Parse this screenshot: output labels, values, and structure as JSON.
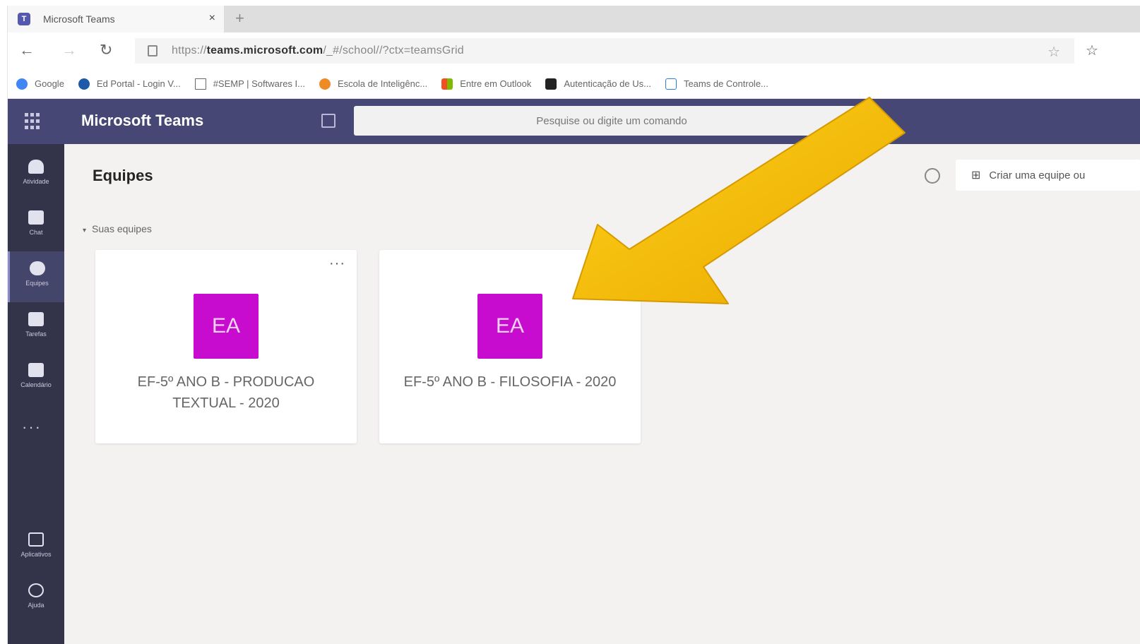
{
  "browser": {
    "tab_title": "Microsoft Teams",
    "tab_close": "×",
    "tab_new": "+",
    "url_prefix": "https://",
    "url_host": "teams.microsoft.com",
    "url_path": "/_#/school//?ctx=teamsGrid",
    "bookmarks": [
      {
        "label": "Google",
        "icon": "google-icon",
        "color": "#4285f4"
      },
      {
        "label": "Ed Portal - Login V...",
        "icon": "portal-icon",
        "color": "#1e5aa8"
      },
      {
        "label": "#SEMP | Softwares I...",
        "icon": "page-icon",
        "color": "#666666"
      },
      {
        "label": "Escola de Inteligênc...",
        "icon": "orange-dot-icon",
        "color": "#f08a24"
      },
      {
        "label": "Entre em Outlook",
        "icon": "microsoft-icon",
        "color": "#f25022"
      },
      {
        "label": "Autenticação de Us...",
        "icon": "auth-icon",
        "color": "#222222"
      },
      {
        "label": "Teams de Controle...",
        "icon": "teams-page-icon",
        "color": "#2b7cd3"
      }
    ]
  },
  "teams": {
    "app_title": "Microsoft Teams",
    "search_placeholder": "Pesquise ou digite um comando",
    "rail": [
      {
        "label": "Atividade",
        "icon": "bell-icon"
      },
      {
        "label": "Chat",
        "icon": "chat-icon"
      },
      {
        "label": "Equipes",
        "icon": "teams-icon",
        "active": true
      },
      {
        "label": "Tarefas",
        "icon": "assignments-icon"
      },
      {
        "label": "Calendário",
        "icon": "calendar-icon"
      }
    ],
    "rail_more": "···",
    "rail_bottom": [
      {
        "label": "Aplicativos",
        "icon": "apps-icon"
      },
      {
        "label": "Ajuda",
        "icon": "help-icon"
      }
    ],
    "page_title": "Equipes",
    "create_button": "Criar uma equipe ou",
    "section_label": "Suas equipes",
    "cards": [
      {
        "initials": "EA",
        "name": "EF-5º ANO B - PRODUCAO TEXTUAL - 2020",
        "more": "···"
      },
      {
        "initials": "EA",
        "name": "EF-5º ANO B - FILOSOFIA - 2020"
      }
    ],
    "colors": {
      "header": "#464775",
      "rail": "#33344a",
      "avatar": "#c70bcf",
      "arrow": "#f5b800"
    }
  }
}
